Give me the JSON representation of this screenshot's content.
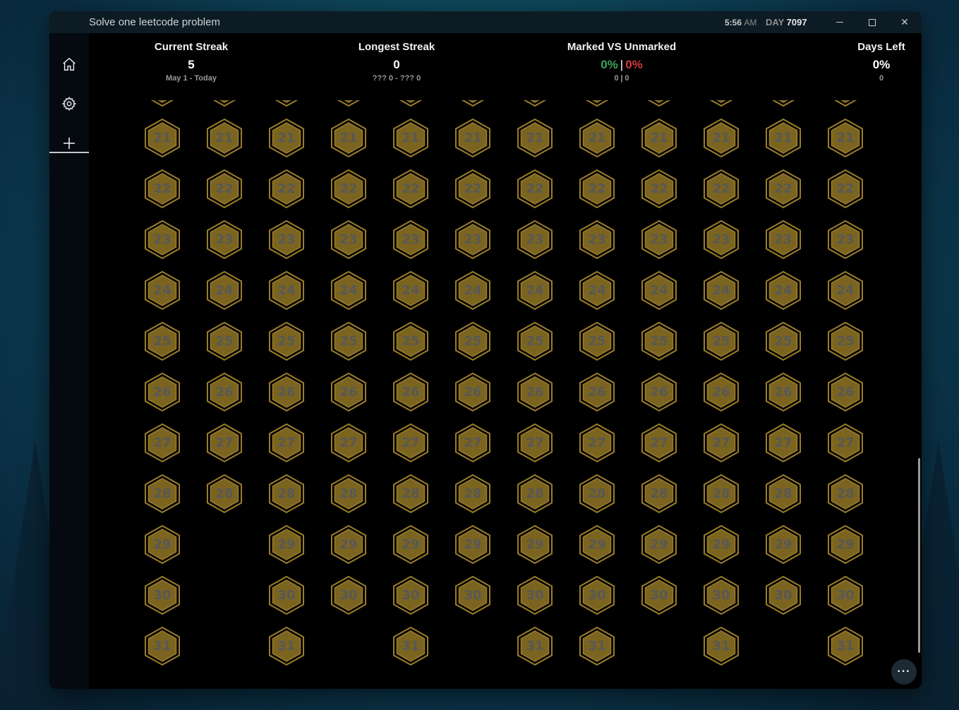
{
  "window": {
    "title": "Solve one leetcode problem",
    "clock_time": "5:56",
    "clock_ampm": "AM",
    "day_label": "DAY",
    "day_number": "7097"
  },
  "window_controls": {
    "close_glyph": "✕"
  },
  "sidebar": {
    "items": [
      {
        "name": "home",
        "icon": "home-icon"
      },
      {
        "name": "settings",
        "icon": "gear-icon"
      },
      {
        "name": "add",
        "icon": "plus-icon"
      }
    ]
  },
  "stats": {
    "current_streak": {
      "title": "Current Streak",
      "value": "5",
      "sub": "May 1 - Today"
    },
    "longest_streak": {
      "title": "Longest Streak",
      "value": "0",
      "sub": "??? 0 - ??? 0"
    },
    "marked_vs_unmarked": {
      "title": "Marked VS Unmarked",
      "marked_pct": "0%",
      "unmarked_pct": "0%",
      "marked_count": "0",
      "unmarked_count": "0",
      "separator": "|"
    },
    "days_left": {
      "title": "Days Left",
      "value": "0%",
      "sub": "0"
    }
  },
  "calendar": {
    "month_days": [
      31,
      28,
      31,
      30,
      31,
      30,
      31,
      31,
      30,
      31,
      30,
      31
    ],
    "visible_days": [
      21,
      22,
      23,
      24,
      25,
      26,
      27,
      28,
      29,
      30,
      31
    ],
    "badge_color": "#7a6420",
    "badge_border": "#9a7d2a",
    "number_color": "#585858"
  },
  "more_button": {
    "label": "···"
  },
  "colors": {
    "accent_green": "#3aa65a",
    "accent_red": "#d33a3a",
    "background": "#000000",
    "sidebar": "#040a10"
  }
}
